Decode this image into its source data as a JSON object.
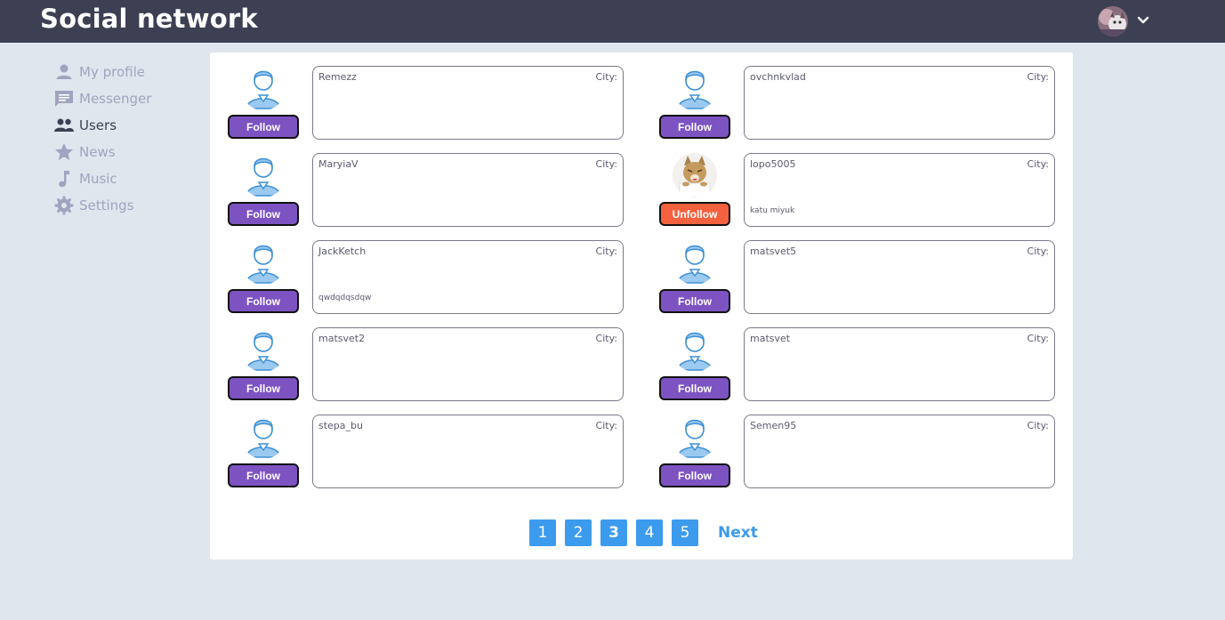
{
  "header": {
    "title": "Social network",
    "accent": "#3d4053"
  },
  "sidebar": {
    "items": [
      {
        "label": "My profile",
        "icon": "person-icon",
        "active": false
      },
      {
        "label": "Messenger",
        "icon": "message-icon",
        "active": false
      },
      {
        "label": "Users",
        "icon": "people-icon",
        "active": true
      },
      {
        "label": "News",
        "icon": "star-icon",
        "active": false
      },
      {
        "label": "Music",
        "icon": "music-note-icon",
        "active": false
      },
      {
        "label": "Settings",
        "icon": "gear-icon",
        "active": false
      }
    ]
  },
  "users": [
    {
      "name": "Remezz",
      "city": "City:",
      "status": "",
      "button": "Follow",
      "followed": false,
      "avatar": "default-user-icon"
    },
    {
      "name": "ovchnkvlad",
      "city": "City:",
      "status": "",
      "button": "Follow",
      "followed": false,
      "avatar": "default-user-icon"
    },
    {
      "name": "MaryiaV",
      "city": "City:",
      "status": "",
      "button": "Follow",
      "followed": false,
      "avatar": "default-user-icon"
    },
    {
      "name": "lopo5005",
      "city": "City:",
      "status": "katu miyuk",
      "button": "Unfollow",
      "followed": true,
      "avatar": "cat-photo"
    },
    {
      "name": "JackKetch",
      "city": "City:",
      "status": "qwdqdqsdqw",
      "button": "Follow",
      "followed": false,
      "avatar": "default-user-icon"
    },
    {
      "name": "matsvet5",
      "city": "City:",
      "status": "",
      "button": "Follow",
      "followed": false,
      "avatar": "default-user-icon"
    },
    {
      "name": "matsvet2",
      "city": "City:",
      "status": "",
      "button": "Follow",
      "followed": false,
      "avatar": "default-user-icon"
    },
    {
      "name": "matsvet",
      "city": "City:",
      "status": "",
      "button": "Follow",
      "followed": false,
      "avatar": "default-user-icon"
    },
    {
      "name": "stepa_bu",
      "city": "City:",
      "status": "",
      "button": "Follow",
      "followed": false,
      "avatar": "default-user-icon"
    },
    {
      "name": "Semen95",
      "city": "City:",
      "status": "",
      "button": "Follow",
      "followed": false,
      "avatar": "default-user-icon"
    }
  ],
  "pagination": {
    "pages": [
      "1",
      "2",
      "3",
      "4",
      "5"
    ],
    "current": "3",
    "next_label": "Next"
  },
  "colors": {
    "follow": "#7d53c2",
    "unfollow": "#f4613e",
    "page": "#3d9bee"
  }
}
